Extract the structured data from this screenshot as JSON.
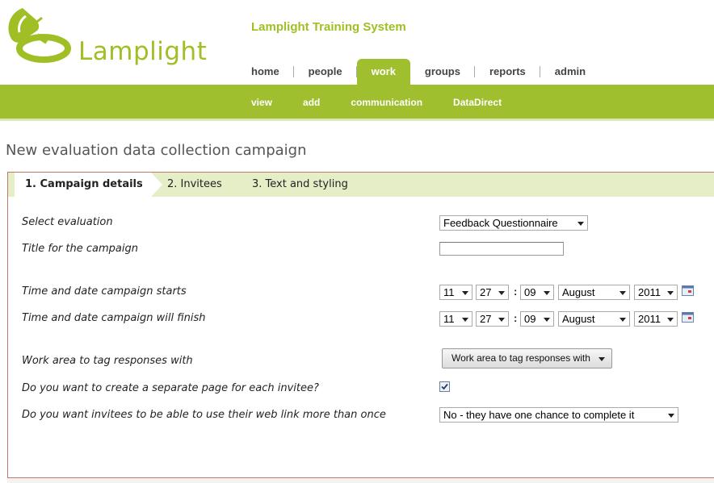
{
  "header": {
    "logo_text": "Lamplight",
    "site_title": "Lamplight Training System",
    "brand_color": "#9fbf2f"
  },
  "topnav": [
    "home",
    "people",
    "work",
    "groups",
    "reports",
    "admin"
  ],
  "topnav_active": "work",
  "subnav": [
    "view",
    "add",
    "communication",
    "DataDirect"
  ],
  "page_title": "New evaluation data collection campaign",
  "steps": [
    "1. Campaign details",
    "2. Invitees",
    "3. Text and styling"
  ],
  "form": {
    "select_evaluation": {
      "label": "Select evaluation",
      "value": "Feedback Questionnaire"
    },
    "title": {
      "label": "Title for the campaign",
      "value": ""
    },
    "start": {
      "label": "Time and date campaign starts",
      "hour": "11",
      "minute": "27",
      "day": "09",
      "month": "August",
      "year": "2011"
    },
    "finish": {
      "label": "Time and date campaign will finish",
      "hour": "11",
      "minute": "27",
      "day": "09",
      "month": "August",
      "year": "2011"
    },
    "work_area": {
      "label": "Work area to tag responses with",
      "button": "Work area to tag responses with"
    },
    "separate_page": {
      "label": "Do you want to create a separate page for each invitee?",
      "checked": true
    },
    "reuse_link": {
      "label": "Do you want invitees to be able to use their web link more than once",
      "value": "No - they have one chance to complete it"
    },
    "colon": ":"
  },
  "icons": [
    "lamp-logo-icon",
    "calendar-icon",
    "chevron-down-icon",
    "checkbox-checked-icon"
  ]
}
